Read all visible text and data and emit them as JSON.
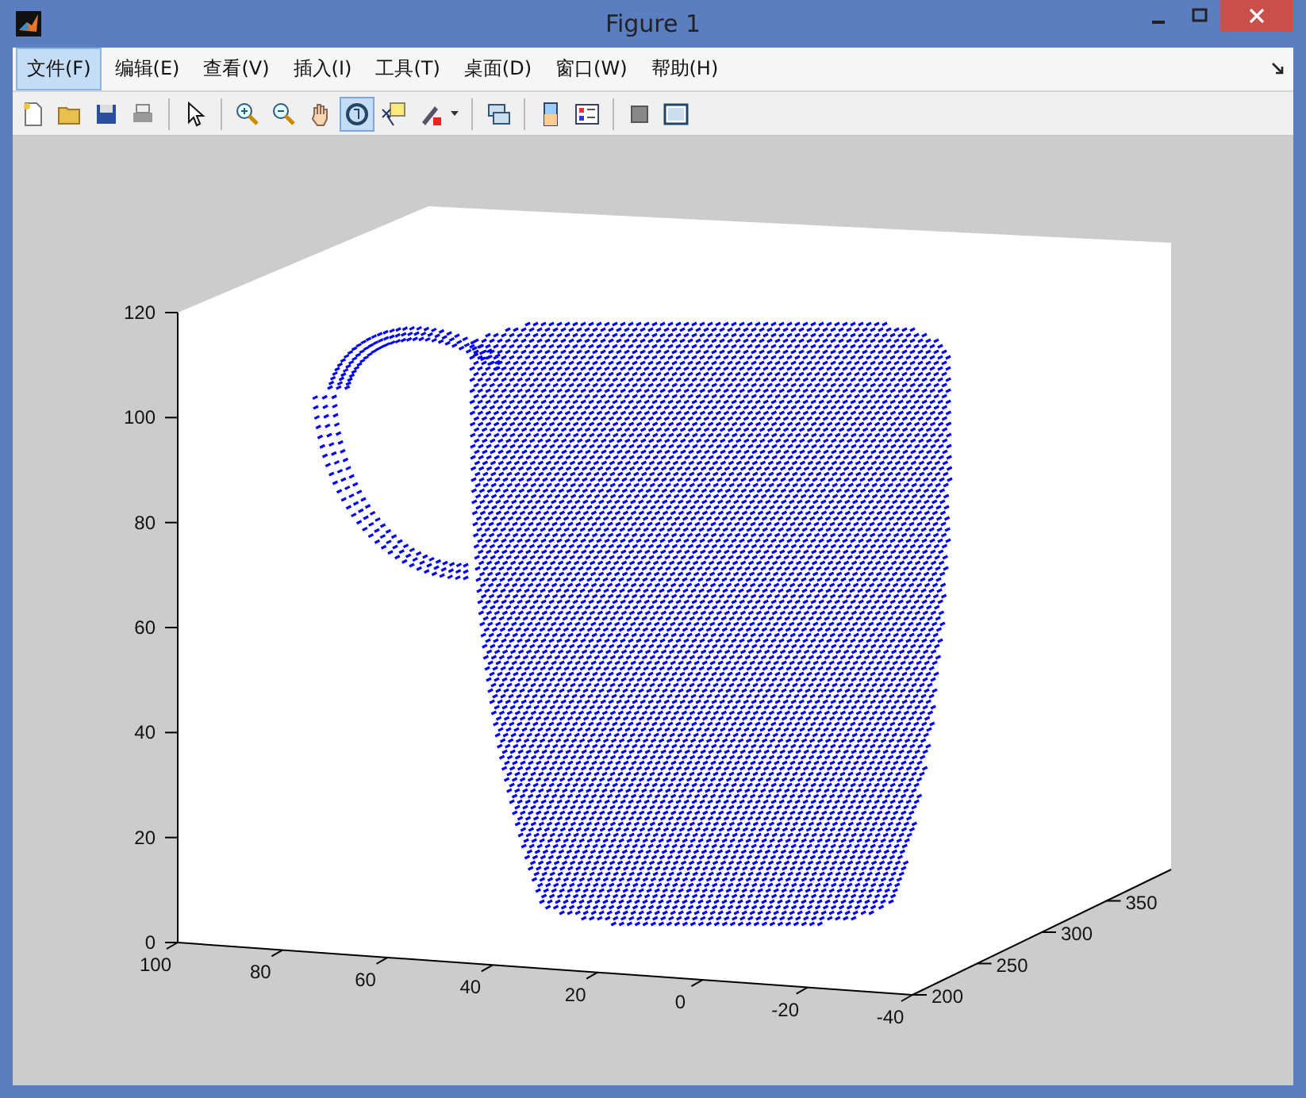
{
  "window": {
    "title": "Figure 1"
  },
  "menu": [
    {
      "label": "文件(F)",
      "selected": true
    },
    {
      "label": "编辑(E)",
      "selected": false
    },
    {
      "label": "查看(V)",
      "selected": false
    },
    {
      "label": "插入(I)",
      "selected": false
    },
    {
      "label": "工具(T)",
      "selected": false
    },
    {
      "label": "桌面(D)",
      "selected": false
    },
    {
      "label": "窗口(W)",
      "selected": false
    },
    {
      "label": "帮助(H)",
      "selected": false
    }
  ],
  "toolbar": [
    {
      "kind": "new",
      "selected": false
    },
    {
      "kind": "open",
      "selected": false
    },
    {
      "kind": "save",
      "selected": false
    },
    {
      "kind": "print",
      "selected": false
    },
    {
      "kind": "sep"
    },
    {
      "kind": "pointer",
      "selected": false
    },
    {
      "kind": "sep"
    },
    {
      "kind": "zoomin",
      "selected": false
    },
    {
      "kind": "zoomout",
      "selected": false
    },
    {
      "kind": "hand",
      "selected": false
    },
    {
      "kind": "rotate",
      "selected": true
    },
    {
      "kind": "cursor",
      "selected": false
    },
    {
      "kind": "brush",
      "selected": false
    },
    {
      "kind": "sep"
    },
    {
      "kind": "link",
      "selected": false
    },
    {
      "kind": "sep"
    },
    {
      "kind": "colorbar",
      "selected": false
    },
    {
      "kind": "legend",
      "selected": false
    },
    {
      "kind": "sep"
    },
    {
      "kind": "square",
      "selected": false
    },
    {
      "kind": "panel",
      "selected": false
    }
  ],
  "plot": {
    "z_ticks": [
      "120",
      "100",
      "80",
      "60",
      "40",
      "20",
      "0"
    ],
    "x_ticks": [
      "100",
      "80",
      "60",
      "40",
      "20",
      "0",
      "-20",
      "-40"
    ],
    "y_ticks": [
      "200",
      "250",
      "300",
      "350"
    ]
  }
}
